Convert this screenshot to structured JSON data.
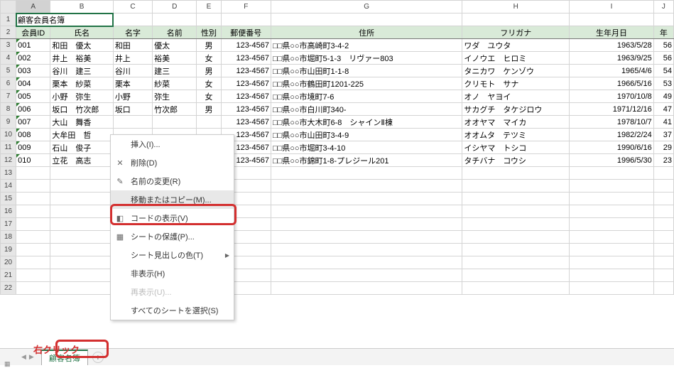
{
  "title": "顧客会員名簿",
  "columns": [
    "A",
    "B",
    "C",
    "D",
    "E",
    "F",
    "G",
    "H",
    "I",
    "J"
  ],
  "headers": {
    "A": "会員ID",
    "B": "氏名",
    "C": "名字",
    "D": "名前",
    "E": "性別",
    "F": "郵便番号",
    "G": "住所",
    "H": "フリガナ",
    "I": "生年月日",
    "J": "年"
  },
  "rows": [
    {
      "id": "001",
      "name": "和田　優太",
      "last": "和田",
      "first": "優太",
      "sex": "男",
      "zip": "123-4567",
      "addr": "□□県○○市高崎町3-4-2",
      "kana": "ワダ　ユウタ",
      "bd": "1963/5/28",
      "age": "56"
    },
    {
      "id": "002",
      "name": "井上　裕美",
      "last": "井上",
      "first": "裕美",
      "sex": "女",
      "zip": "123-4567",
      "addr": "□□県○○市堀町5-1-3　リヴァー803",
      "kana": "イノウエ　ヒロミ",
      "bd": "1963/9/25",
      "age": "56"
    },
    {
      "id": "003",
      "name": "谷川　建三",
      "last": "谷川",
      "first": "建三",
      "sex": "男",
      "zip": "123-4567",
      "addr": "□□県○○市山田町1-1-8",
      "kana": "タニカワ　ケンゾウ",
      "bd": "1965/4/6",
      "age": "54"
    },
    {
      "id": "004",
      "name": "栗本　紗菜",
      "last": "栗本",
      "first": "紗菜",
      "sex": "女",
      "zip": "123-4567",
      "addr": "□□県○○市鶴田町1201-225",
      "kana": "クリモト　サナ",
      "bd": "1966/5/16",
      "age": "53"
    },
    {
      "id": "005",
      "name": "小野　弥生",
      "last": "小野",
      "first": "弥生",
      "sex": "女",
      "zip": "123-4567",
      "addr": "□□県○○市境町7-6",
      "kana": "オノ　ヤヨイ",
      "bd": "1970/10/8",
      "age": "49"
    },
    {
      "id": "006",
      "name": "坂口　竹次郎",
      "last": "坂口",
      "first": "竹次郎",
      "sex": "男",
      "zip": "123-4567",
      "addr": "□□県○○市白川町340-",
      "kana": "サカグチ　タケジロウ",
      "bd": "1971/12/16",
      "age": "47"
    },
    {
      "id": "007",
      "name": "大山　舞香",
      "last": "",
      "first": "",
      "sex": "",
      "zip": "123-4567",
      "addr": "□□県○○市大木町6-8　シャインⅡ棟",
      "kana": "オオヤマ　マイカ",
      "bd": "1978/10/7",
      "age": "41"
    },
    {
      "id": "008",
      "name": "大牟田　哲",
      "last": "",
      "first": "",
      "sex": "",
      "zip": "123-4567",
      "addr": "□□県○○市山田町3-4-9",
      "kana": "オオムタ　テツミ",
      "bd": "1982/2/24",
      "age": "37"
    },
    {
      "id": "009",
      "name": "石山　俊子",
      "last": "",
      "first": "",
      "sex": "",
      "zip": "123-4567",
      "addr": "□□県○○市堀町3-4-10",
      "kana": "イシヤマ　トシコ",
      "bd": "1990/6/16",
      "age": "29"
    },
    {
      "id": "010",
      "name": "立花　高志",
      "last": "",
      "first": "",
      "sex": "",
      "zip": "123-4567",
      "addr": "□□県○○市錦町1-8-プレジール201",
      "kana": "タチバナ　コウシ",
      "bd": "1996/5/30",
      "age": "23"
    }
  ],
  "sheet_tab": "顧客名簿",
  "context_menu": {
    "insert": "挿入(I)...",
    "delete": "削除(D)",
    "rename": "名前の変更(R)",
    "move_copy": "移動またはコピー(M)...",
    "view_code": "コードの表示(V)",
    "protect": "シートの保護(P)...",
    "tab_color": "シート見出しの色(T)",
    "hide": "非表示(H)",
    "unhide": "再表示(U)...",
    "select_all": "すべてのシートを選択(S)"
  },
  "annotation_label": "右クリック"
}
